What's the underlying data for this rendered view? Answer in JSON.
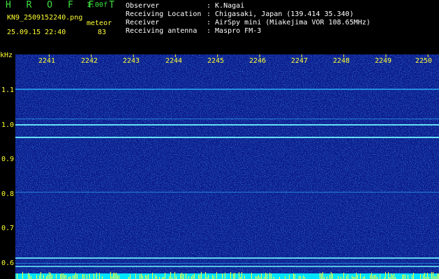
{
  "header": {
    "app_title": "H R O F F T",
    "version": "1.00f",
    "filename": "KN9_2509152240.png",
    "datetime": "25.09.15 22:40",
    "meteor_label": "meteor",
    "meteor_count": "83"
  },
  "info": [
    {
      "key": "Observer",
      "value": ": K.Nagai"
    },
    {
      "key": "Receiving Location",
      "value": ": Chigasaki, Japan (139.414 35.340)"
    },
    {
      "key": "Receiver",
      "value": ": AirSpy mini (Miakejima VOR 108.65MHz)"
    },
    {
      "key": "Receiving antenna",
      "value": ": Maspro FM-3"
    }
  ],
  "yaxis": {
    "unit": "kHz",
    "ticks": [
      "1.1",
      "1.0",
      "0.9",
      "0.8",
      "0.7",
      "0.6"
    ]
  },
  "xaxis": {
    "ticks": [
      "2241",
      "2242",
      "2243",
      "2244",
      "2245",
      "2246",
      "2247",
      "2248",
      "2249",
      "2250"
    ]
  },
  "colors": {
    "background": "#000000",
    "spectrogram_base": "#0b1a8a",
    "signal": "#00e5ff",
    "label_yellow": "#ffff33",
    "title_green": "#3ee23e"
  }
}
